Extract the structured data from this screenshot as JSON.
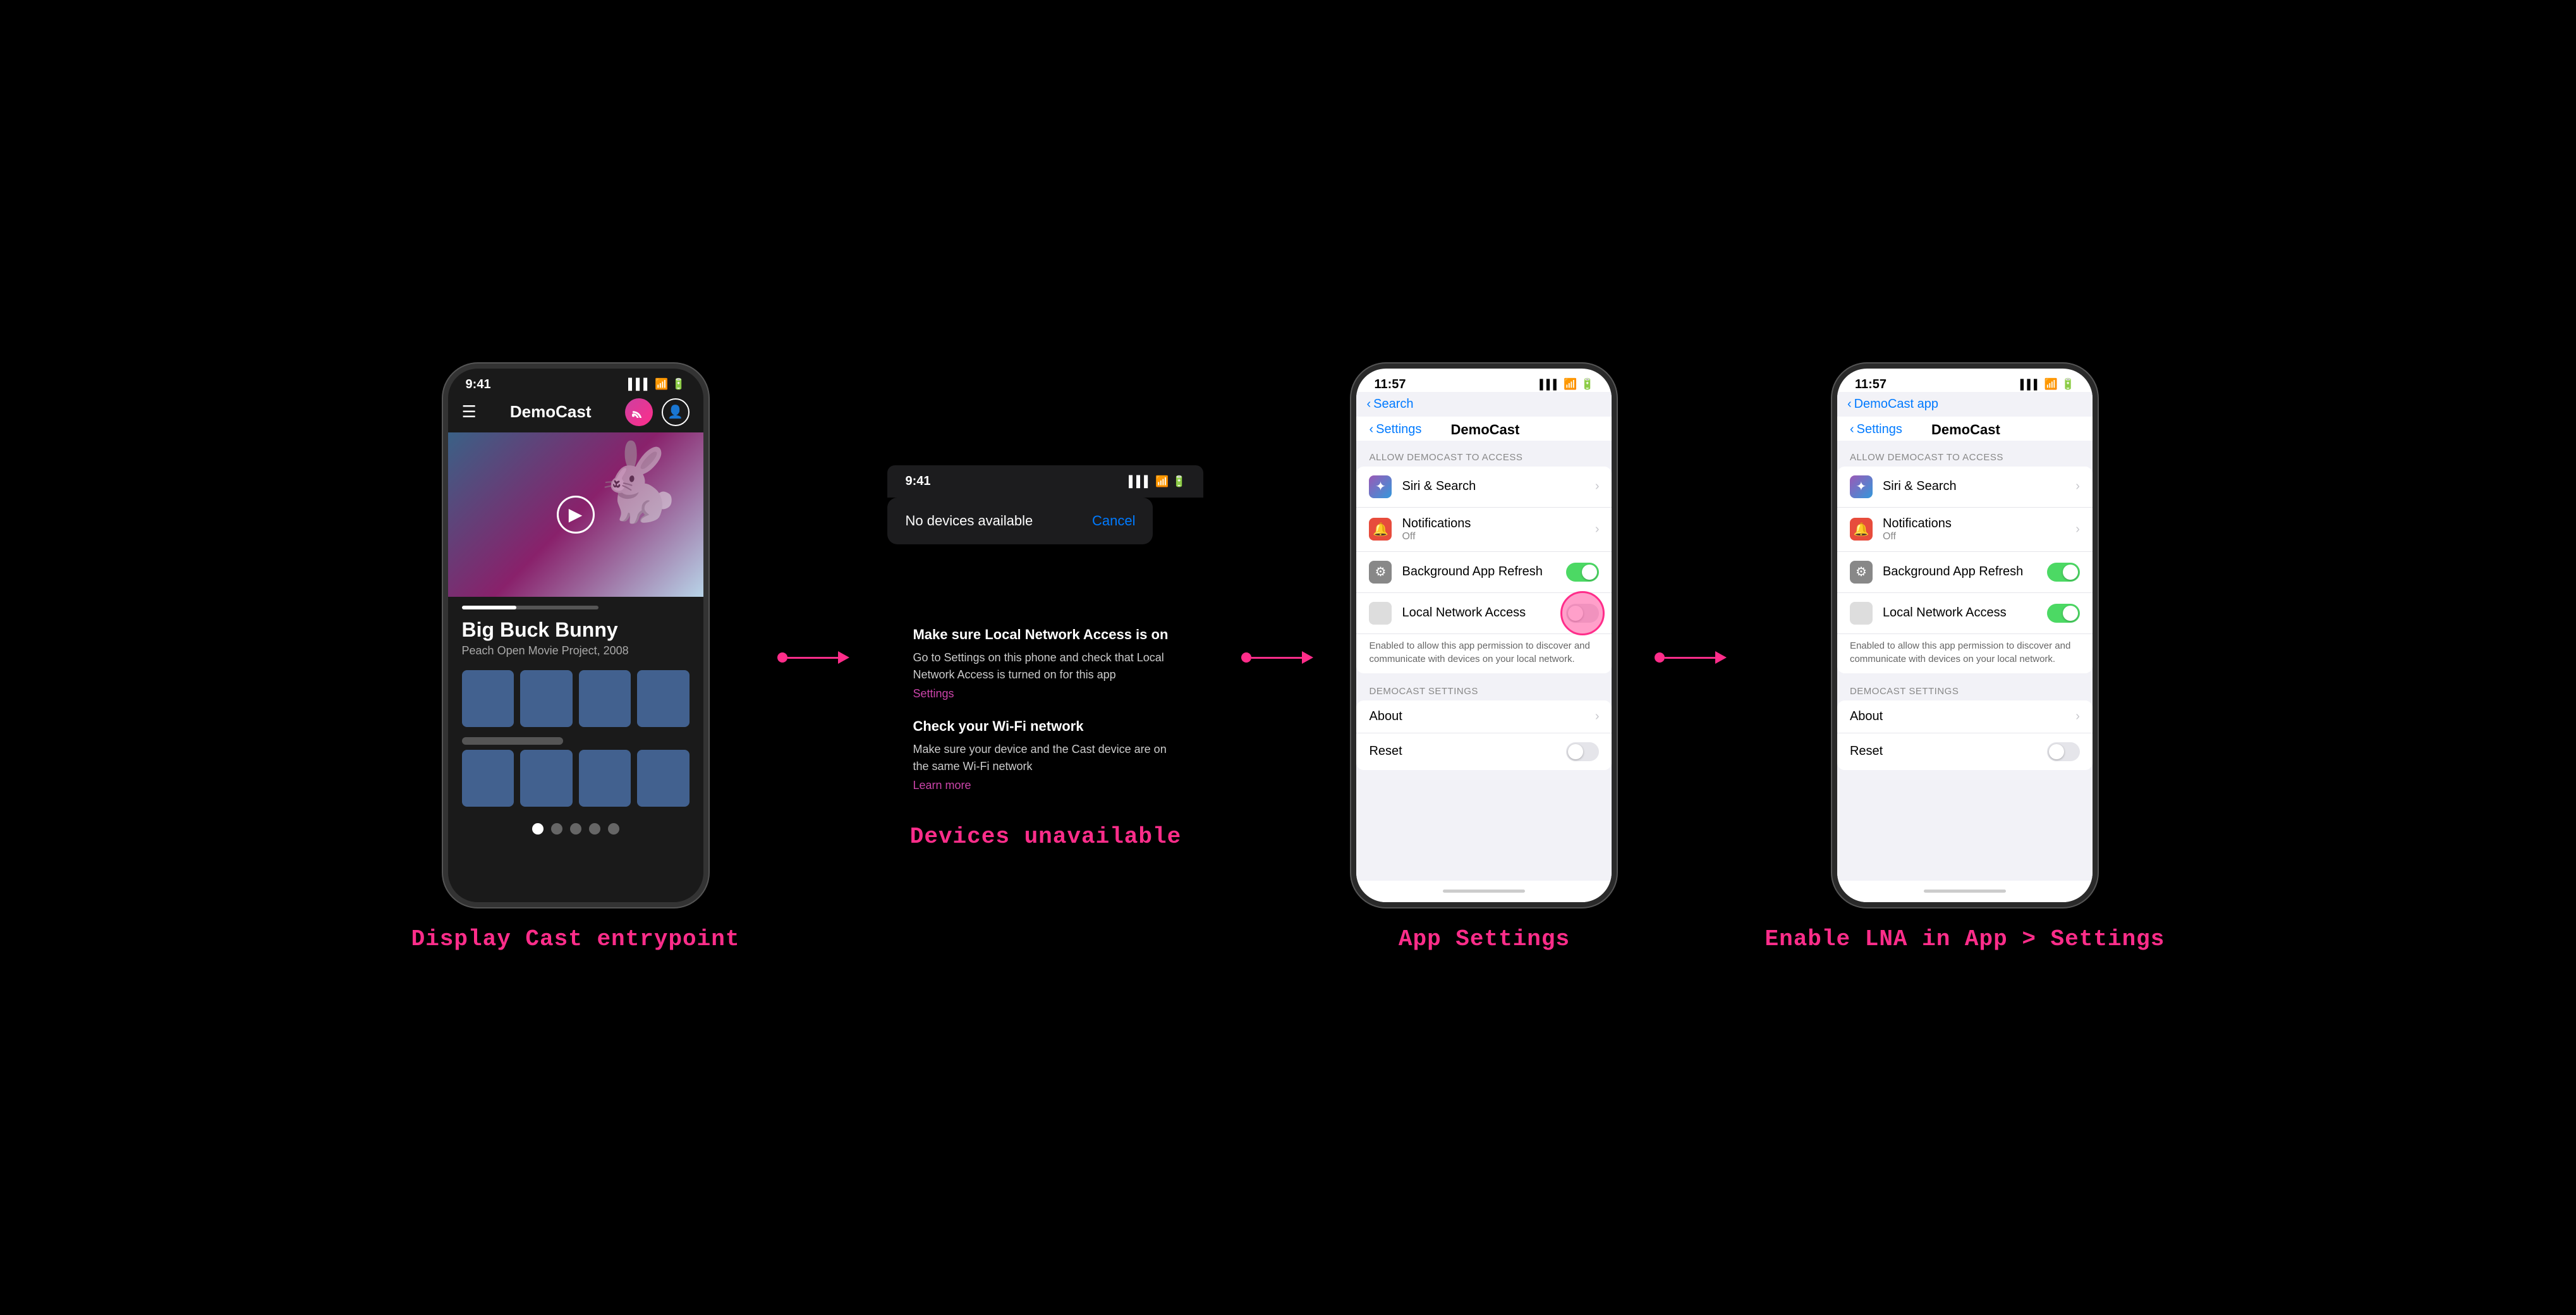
{
  "captions": {
    "col1": "Display Cast entrypoint",
    "col2": "Devices unavailable",
    "col3": "App Settings",
    "col4": "Enable LNA in App > Settings"
  },
  "phone1": {
    "status_time": "9:41",
    "app_title": "DemoCast",
    "movie_title": "Big Buck Bunny",
    "movie_subtitle": "Peach Open Movie Project, 2008"
  },
  "dialog": {
    "no_devices": "No devices available",
    "cancel": "Cancel"
  },
  "troubleshoot": {
    "heading1": "Make sure Local Network Access is on",
    "text1": "Go to Settings on this phone and check that Local Network Access is turned on for this app",
    "link1": "Settings",
    "heading2": "Check your Wi-Fi network",
    "text2": "Make sure your device and the Cast device are on the same Wi-Fi network",
    "link2": "Learn more"
  },
  "phone3": {
    "status_time": "11:57",
    "back_label": "Settings",
    "title": "DemoCast",
    "search_placeholder": "Search",
    "section_header": "ALLOW DEMOCAST TO ACCESS",
    "rows": [
      {
        "icon": "siri",
        "label": "Siri & Search",
        "type": "chevron"
      },
      {
        "icon": "notif",
        "label": "Notifications",
        "sublabel": "Off",
        "type": "chevron"
      },
      {
        "icon": "bg",
        "label": "Background App Refresh",
        "type": "toggle-on"
      },
      {
        "icon": "network",
        "label": "Local Network Access",
        "type": "toggle-off-pink"
      }
    ],
    "network_desc": "Enabled to allow this app permission to discover and communicate with devices on your local network.",
    "section2_header": "DEMOCAST SETTINGS",
    "rows2": [
      {
        "label": "About",
        "type": "chevron"
      },
      {
        "label": "Reset",
        "type": "toggle-off"
      }
    ]
  },
  "phone4": {
    "status_time": "11:57",
    "back_label": "DemoCast app",
    "title": "DemoCast",
    "section_header": "ALLOW DEMOCAST TO ACCESS",
    "rows": [
      {
        "icon": "siri",
        "label": "Siri & Search",
        "type": "chevron"
      },
      {
        "icon": "notif",
        "label": "Notifications",
        "sublabel": "Off",
        "type": "chevron"
      },
      {
        "icon": "bg",
        "label": "Background App Refresh",
        "type": "toggle-on"
      },
      {
        "icon": "network",
        "label": "Local Network Access",
        "type": "toggle-on"
      }
    ],
    "network_desc": "Enabled to allow this app permission to discover and communicate with devices on your local network.",
    "section2_header": "DEMOCAST SETTINGS",
    "rows2": [
      {
        "label": "About",
        "type": "chevron"
      },
      {
        "label": "Reset",
        "type": "toggle-off"
      }
    ]
  }
}
